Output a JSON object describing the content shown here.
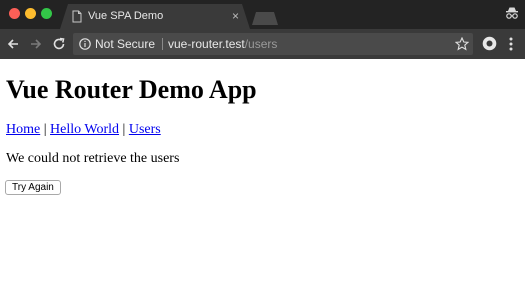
{
  "browser": {
    "tab_title": "Vue SPA Demo",
    "tab_close": "×",
    "security_label": "Not Secure",
    "url_host": "vue-router.test",
    "url_path": "/users"
  },
  "page": {
    "title": "Vue Router Demo App",
    "nav": {
      "home": "Home",
      "sep1": " | ",
      "hello": "Hello World",
      "sep2": " | ",
      "users": "Users"
    },
    "error_message": "We could not retrieve the users",
    "retry_label": "Try Again"
  },
  "colors": {
    "chrome_dark": "#232323",
    "toolbar": "#3a3a3a",
    "link": "#0000ee"
  }
}
